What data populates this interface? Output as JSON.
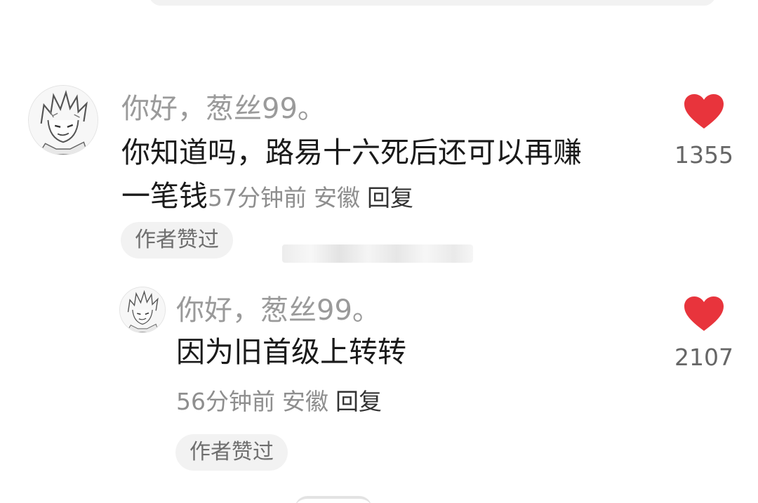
{
  "comment": {
    "username": "你好，葱丝99。",
    "text_line1": "你知道吗，路易十六死后还可以再赚",
    "text_line2": "一笔钱",
    "time": "57分钟前",
    "location": "安徽",
    "reply_label": "回复",
    "author_like_badge": "作者赞过",
    "like_count": "1355",
    "avatar_icon": "anime-avatar-icon",
    "heart_icon": "heart-icon"
  },
  "reply": {
    "username": "你好，葱丝99。",
    "text": "因为旧首级上转转",
    "time": "56分钟前",
    "location": "安徽",
    "reply_label": "回复",
    "author_like_badge": "作者赞过",
    "like_count": "2107",
    "avatar_icon": "anime-avatar-icon",
    "heart_icon": "heart-icon"
  },
  "colors": {
    "heart": "#e8343c",
    "username": "#9a9a9a",
    "text": "#1a1a1a",
    "badge_bg": "#f2f2f2"
  }
}
